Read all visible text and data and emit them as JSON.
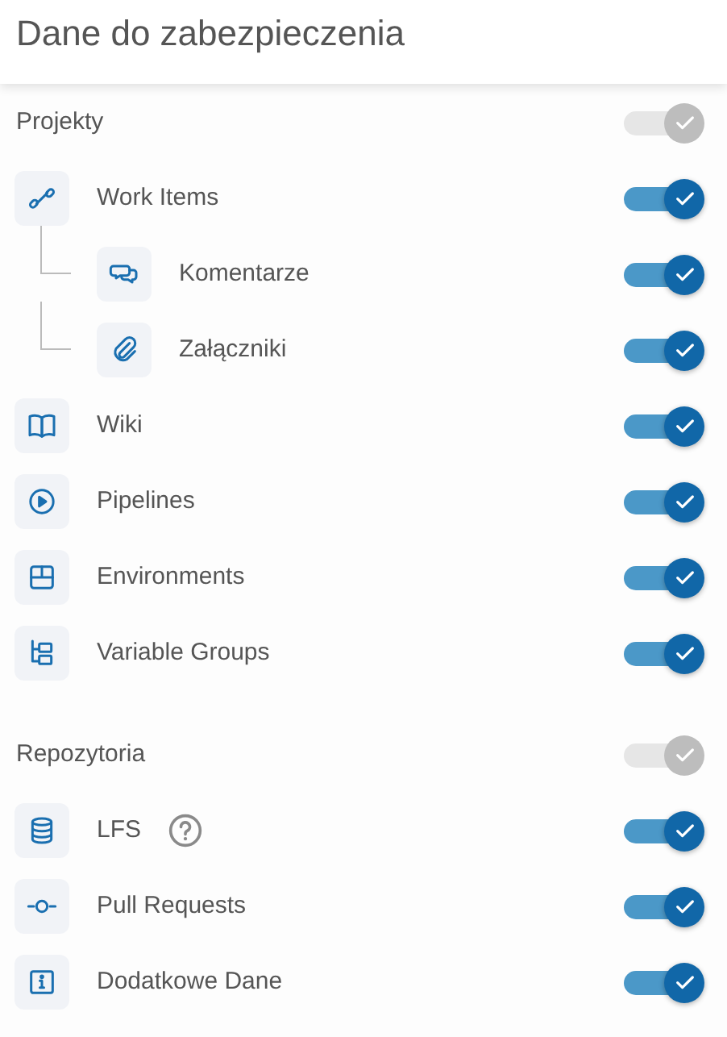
{
  "header": {
    "title": "Dane do zabezpieczenia"
  },
  "sections": [
    {
      "label": "Projekty",
      "on": true,
      "disabled": true,
      "items": [
        {
          "label": "Work Items",
          "on": true,
          "disabled": false,
          "children": [
            {
              "label": "Komentarze",
              "on": true,
              "disabled": false
            },
            {
              "label": "Załączniki",
              "on": true,
              "disabled": false
            }
          ]
        },
        {
          "label": "Wiki",
          "on": true,
          "disabled": false
        },
        {
          "label": "Pipelines",
          "on": true,
          "disabled": false
        },
        {
          "label": "Environments",
          "on": true,
          "disabled": false
        },
        {
          "label": "Variable Groups",
          "on": true,
          "disabled": false
        }
      ]
    },
    {
      "label": "Repozytoria",
      "on": true,
      "disabled": true,
      "items": [
        {
          "label": "LFS",
          "on": true,
          "disabled": false,
          "help": true
        },
        {
          "label": "Pull Requests",
          "on": true,
          "disabled": false
        },
        {
          "label": "Dodatkowe Dane",
          "on": true,
          "disabled": false
        }
      ]
    }
  ]
}
